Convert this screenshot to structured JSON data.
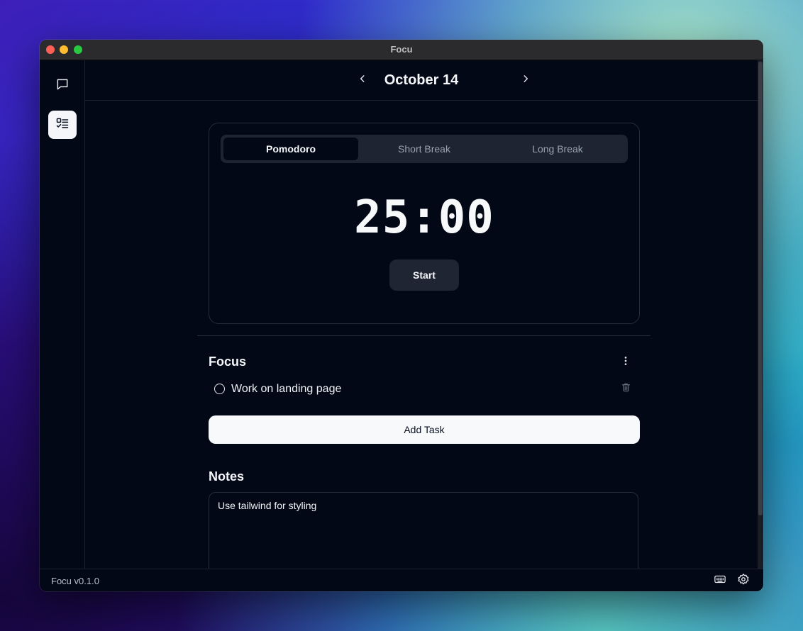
{
  "window": {
    "title": "Focu"
  },
  "sidebar": {
    "items": [
      {
        "icon": "chat-icon",
        "active": false
      },
      {
        "icon": "checklist-icon",
        "active": true
      }
    ]
  },
  "header": {
    "date": "October 14",
    "prev_icon": "chevron-left-icon",
    "next_icon": "chevron-right-icon"
  },
  "timer": {
    "tabs": [
      {
        "label": "Pomodoro",
        "active": true
      },
      {
        "label": "Short Break",
        "active": false
      },
      {
        "label": "Long Break",
        "active": false
      }
    ],
    "display": "25:00",
    "start_label": "Start"
  },
  "focus": {
    "title": "Focus",
    "tasks": [
      {
        "label": "Work on landing page",
        "done": false
      }
    ],
    "add_task_label": "Add Task"
  },
  "notes": {
    "title": "Notes",
    "content": "Use tailwind for styling"
  },
  "status": {
    "version": "Focu v0.1.0",
    "icons": [
      "keyboard-icon",
      "settings-icon"
    ]
  }
}
